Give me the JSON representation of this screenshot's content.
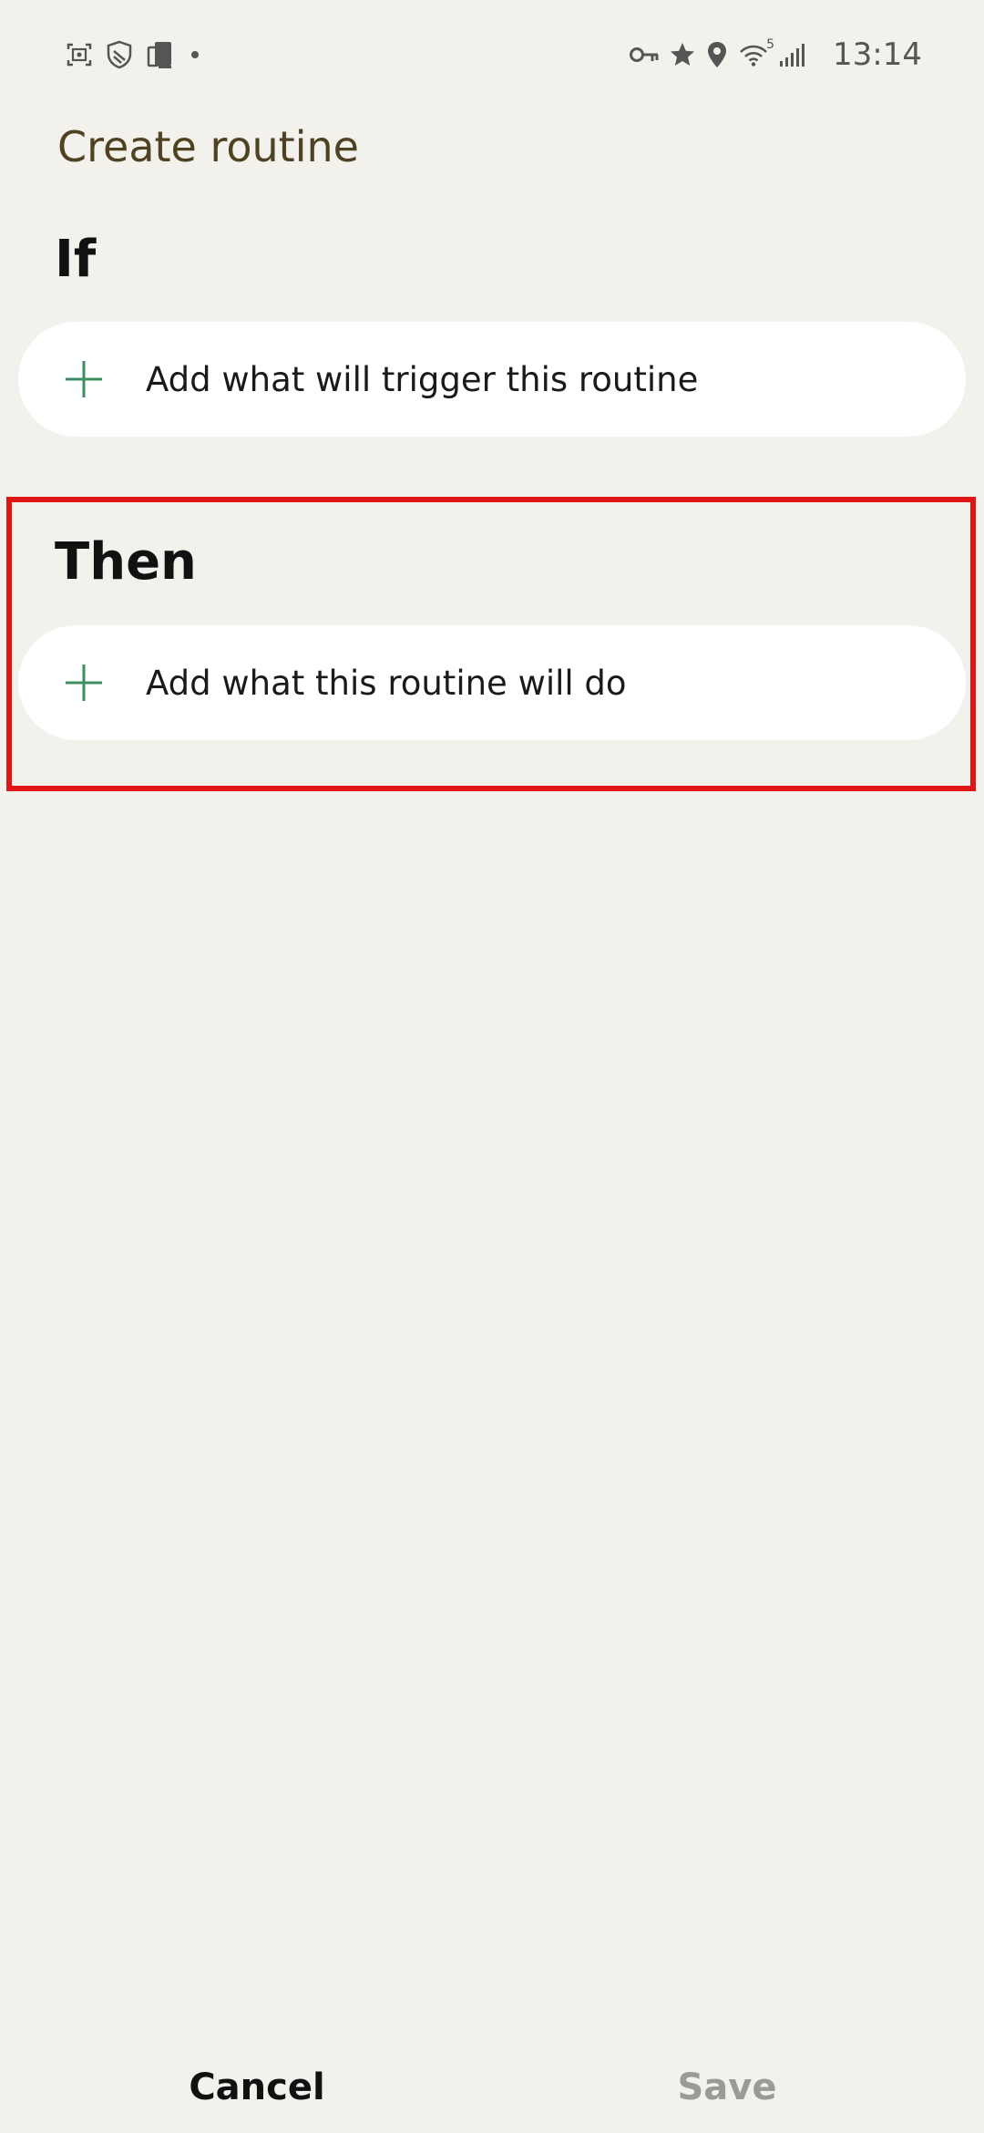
{
  "status_bar": {
    "time": "13:14",
    "left_icons": [
      "screenshot-icon",
      "shield-icon",
      "device-icon",
      "dot-icon"
    ],
    "right_icons": [
      "key-icon",
      "star-icon",
      "location-icon",
      "wifi-icon",
      "signal-icon"
    ],
    "wifi_label": "5"
  },
  "header": {
    "title": "Create routine"
  },
  "if_section": {
    "heading": "If",
    "add_label": "Add what will trigger this routine"
  },
  "then_section": {
    "heading": "Then",
    "add_label": "Add what this routine will do"
  },
  "bottom_bar": {
    "cancel_label": "Cancel",
    "save_label": "Save"
  },
  "colors": {
    "background": "#f2f1ec",
    "title": "#4f4222",
    "accent_plus": "#3e8e63",
    "highlight": "#e01616",
    "disabled": "#9a9a96"
  }
}
